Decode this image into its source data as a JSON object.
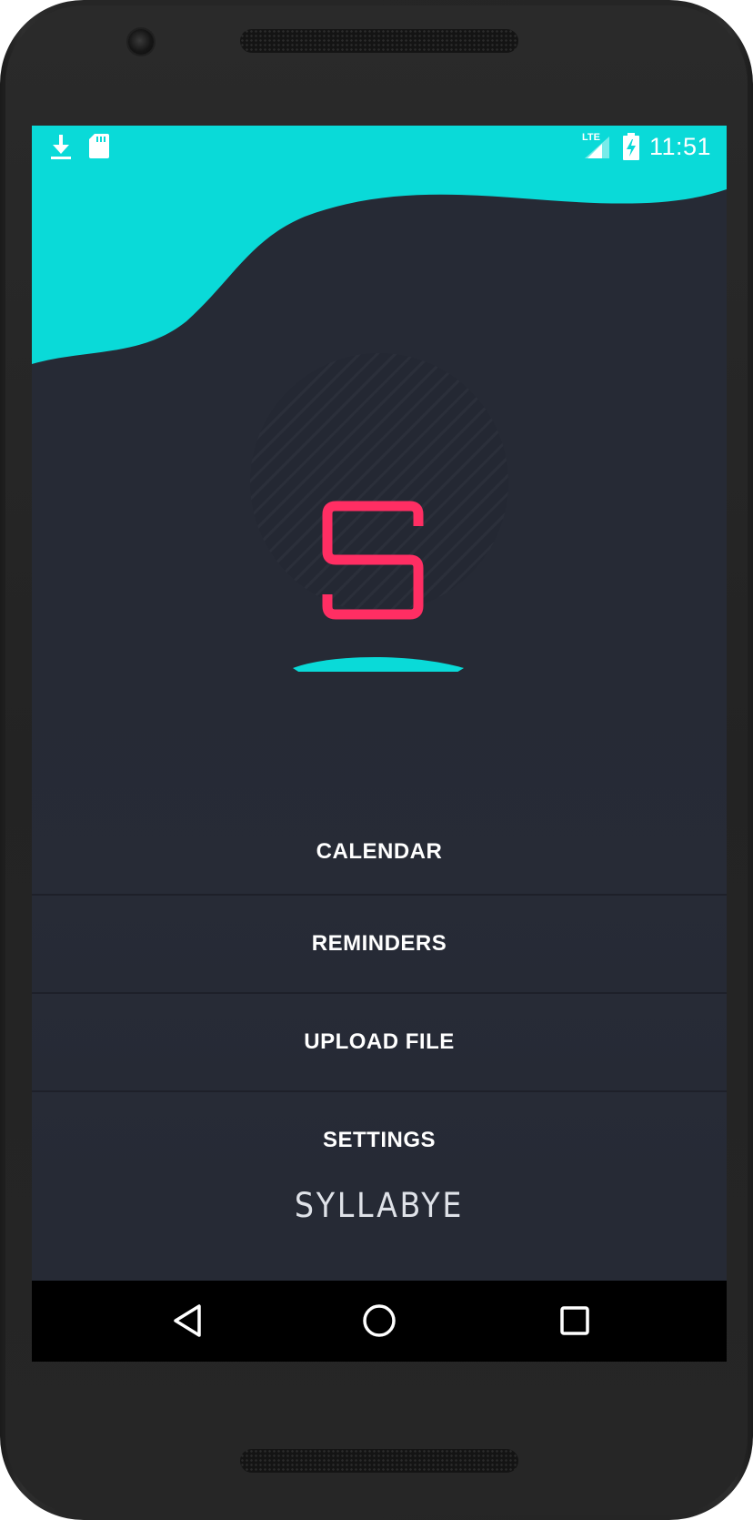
{
  "status_bar": {
    "time": "11:51",
    "network_label": "LTE",
    "left_icons": [
      "download-icon",
      "sd-card-icon"
    ],
    "right_icons": [
      "signal-icon",
      "battery-charging-icon"
    ]
  },
  "logo": {
    "letter": "S"
  },
  "menu": {
    "items": [
      {
        "label": "CALENDAR"
      },
      {
        "label": "REMINDERS"
      },
      {
        "label": "UPLOAD FILE"
      },
      {
        "label": "SETTINGS"
      }
    ]
  },
  "brand": {
    "name": "SYLLABYE"
  },
  "nav_bar": {
    "buttons": [
      "back-icon",
      "home-icon",
      "recents-icon"
    ]
  },
  "colors": {
    "accent_teal": "#0adad8",
    "logo_pink": "#ff2e63",
    "background": "#262a35",
    "text": "#ffffff"
  }
}
